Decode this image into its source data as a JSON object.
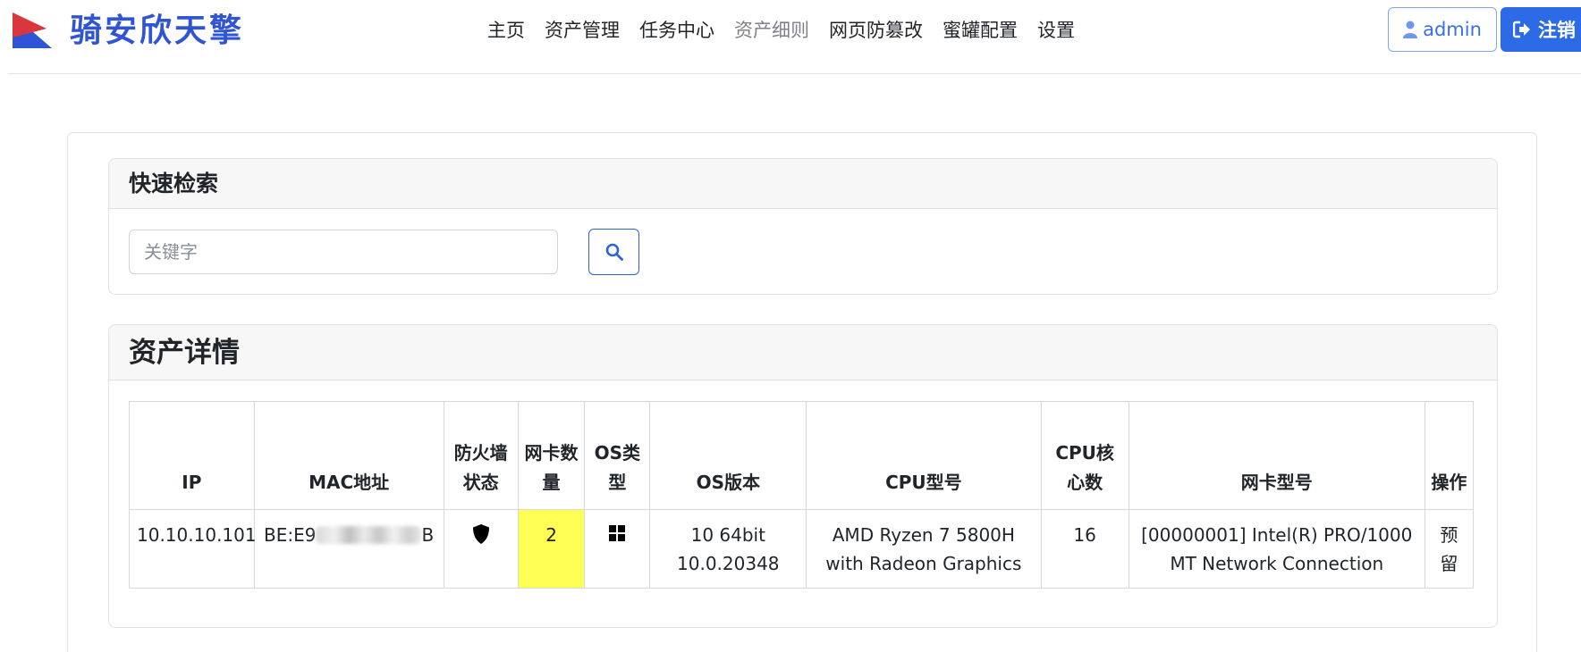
{
  "brand": {
    "name": "骑安欣天擎"
  },
  "nav": {
    "items": [
      {
        "label": "主页",
        "active": false
      },
      {
        "label": "资产管理",
        "active": false
      },
      {
        "label": "任务中心",
        "active": false
      },
      {
        "label": "资产细则",
        "active": true
      },
      {
        "label": "网页防篡改",
        "active": false
      },
      {
        "label": "蜜罐配置",
        "active": false
      },
      {
        "label": "设置",
        "active": false
      }
    ]
  },
  "user": {
    "name": "admin",
    "logout_label": "注销"
  },
  "search": {
    "title": "快速检索",
    "placeholder": "关键字",
    "value": ""
  },
  "details": {
    "title": "资产详情",
    "columns": [
      "IP",
      "MAC地址",
      "防火墙状态",
      "网卡数量",
      "OS类型",
      "OS版本",
      "CPU型号",
      "CPU核心数",
      "网卡型号",
      "操作"
    ],
    "rows": [
      {
        "ip": "10.10.10.101",
        "mac_prefix": "BE:E9",
        "mac_suffix": "B",
        "firewall_icon": "shield-icon",
        "nic_count": "2",
        "os_type_icon": "windows-icon",
        "os_version": "10 64bit 10.0.20348",
        "cpu_model": "AMD Ryzen 7 5800H with Radeon Graphics",
        "cpu_cores": "16",
        "nic_model": "[00000001] Intel(R) PRO/1000 MT Network Connection",
        "action": "预留"
      }
    ]
  },
  "colors": {
    "brand": "#2f55d4",
    "primary": "#2c6ae6",
    "highlight": "#ffff55",
    "logo_red": "#d9363e"
  }
}
